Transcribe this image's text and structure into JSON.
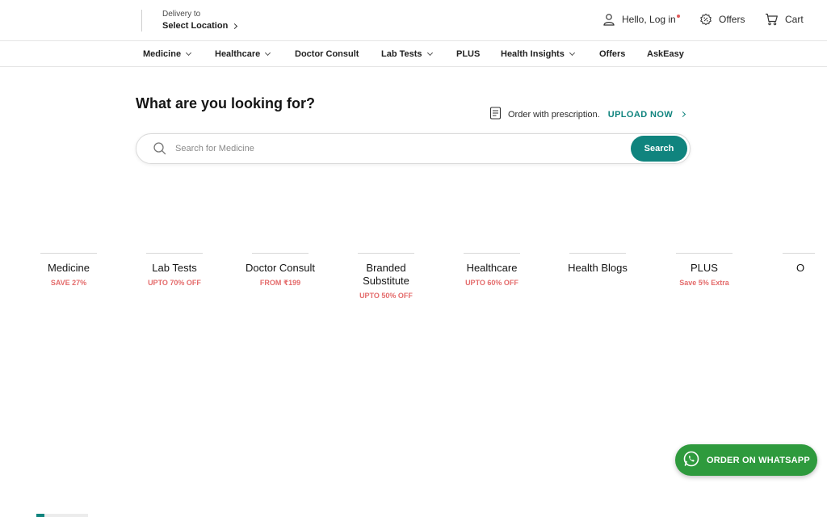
{
  "header": {
    "delivery_label": "Delivery to",
    "location_label": "Select Location",
    "login_label": "Hello, Log in",
    "offers_label": "Offers",
    "cart_label": "Cart"
  },
  "nav": {
    "items": [
      {
        "label": "Medicine",
        "dropdown": true
      },
      {
        "label": "Healthcare",
        "dropdown": true
      },
      {
        "label": "Doctor Consult",
        "dropdown": false
      },
      {
        "label": "Lab Tests",
        "dropdown": true
      },
      {
        "label": "PLUS",
        "dropdown": false
      },
      {
        "label": "Health Insights",
        "dropdown": true
      },
      {
        "label": "Offers",
        "dropdown": false
      },
      {
        "label": "AskEasy",
        "dropdown": false
      }
    ]
  },
  "search": {
    "heading": "What are you looking for?",
    "prescription_text": "Order with prescription.",
    "upload_label": "UPLOAD NOW",
    "placeholder": "Search for Medicine",
    "button_label": "Search"
  },
  "categories": [
    {
      "name": "Medicine",
      "offer": "SAVE 27%"
    },
    {
      "name": "Lab Tests",
      "offer": "UPTO 70% OFF"
    },
    {
      "name": "Doctor Consult",
      "offer": "FROM ₹199"
    },
    {
      "name": "Branded Substitute",
      "offer": "UPTO 50% OFF"
    },
    {
      "name": "Healthcare",
      "offer": "UPTO 60% OFF"
    },
    {
      "name": "Health Blogs",
      "offer": ""
    },
    {
      "name": "PLUS",
      "offer": "Save 5% Extra"
    },
    {
      "name": "O",
      "offer": ""
    }
  ],
  "whatsapp": {
    "label": "ORDER ON WHATSAPP"
  },
  "colors": {
    "brand": "#10847e",
    "offer": "#e46b6b",
    "whatsapp": "#2e9a3d"
  },
  "icons": {
    "user": "user-icon",
    "offers": "offers-badge-icon",
    "cart": "cart-icon",
    "search": "search-icon",
    "prescription": "prescription-icon",
    "whatsapp": "whatsapp-icon"
  }
}
